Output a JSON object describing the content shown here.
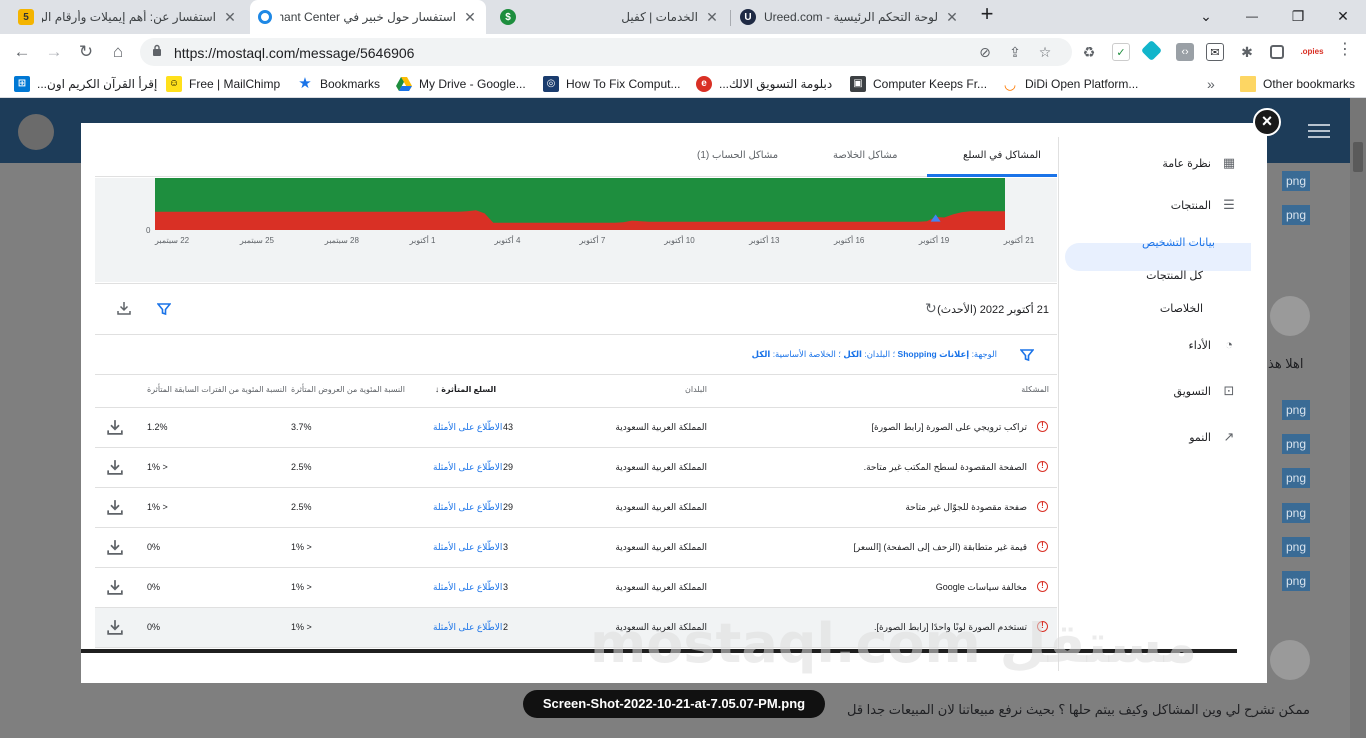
{
  "tabs": [
    {
      "label": "استفسار عن: أهم إيميلات وأرقام الن",
      "favicon": "5",
      "active": false
    },
    {
      "label": "استفسار حول خبير في hant Center",
      "favicon": "o",
      "active": true
    },
    {
      "label": "",
      "favicon": "$",
      "active": false
    },
    {
      "label": "الخدمات | كفيل",
      "favicon": "",
      "active": false
    },
    {
      "label": "لوحة التحكم الرئيسية - Ureed.com",
      "favicon": "U",
      "active": false
    }
  ],
  "new_tab_label": "+",
  "window_controls": {
    "chevron": "⌄",
    "minimize": "—",
    "restore": "❐",
    "close": "✕"
  },
  "address_bar": {
    "url": "https://mostaql.com/message/5646906"
  },
  "bookmarks": [
    {
      "label": "إقرأ القرآن الكريم اون...",
      "icon": "windows-icon"
    },
    {
      "label": "Free | MailChimp",
      "icon": "mailchimp-icon"
    },
    {
      "label": "Bookmarks",
      "icon": "star-icon"
    },
    {
      "label": "My Drive - Google...",
      "icon": "drive-icon"
    },
    {
      "label": "How To Fix Comput...",
      "icon": "globe-icon"
    },
    {
      "label": "دبلومة التسويق الالك...",
      "icon": "red-logo-icon"
    },
    {
      "label": "Computer Keeps Fr...",
      "icon": "square-icon"
    },
    {
      "label": "DiDi Open Platform...",
      "icon": "didi-icon"
    }
  ],
  "more_bookmarks": "»",
  "other_bookmarks": "Other bookmarks",
  "page_behind": {
    "png_label": "png",
    "comment_text": "اهلا هذ",
    "bottom_text": "ممكن تشرح لي وين المشاكل وكيف بيتم حلها ؟ بحيث نرفع مبيعاتنا لان المبيعات جدا قل"
  },
  "modal": {
    "close_label": "×",
    "caption": "Screen-Shot-2022-10-21-at-7.05.07-PM.png",
    "watermark": "مستقل mostaql.com"
  },
  "merchant_center": {
    "sidenav": [
      {
        "label": "نظرة عامة",
        "icon": "overview-icon"
      },
      {
        "label": "المنتجات",
        "icon": "products-icon"
      },
      {
        "label": "بيانات التشخيص",
        "sub": true,
        "active": true
      },
      {
        "label": "كل المنتجات",
        "sub": true
      },
      {
        "label": "الخلاصات",
        "sub": true
      },
      {
        "label": "الأداء",
        "icon": "performance-icon"
      },
      {
        "label": "التسويق",
        "icon": "marketing-icon"
      },
      {
        "label": "النمو",
        "icon": "growth-icon"
      }
    ],
    "tabs": [
      {
        "label": "المشاكل في السلع",
        "active": true
      },
      {
        "label": "مشاكل الخلاصة",
        "active": false
      },
      {
        "label": "مشاكل الحساب (1)",
        "active": false
      }
    ],
    "date_label": "21 أكتوبر 2022 (الأحدث)",
    "filter_text": {
      "prefix": "الوجهة:",
      "destination": "إعلانات Shopping",
      "middle": "؛ البلدان:",
      "country": "الكل",
      "suffix": "؛ الخلاصة الأساسية:",
      "feed": "الكل"
    },
    "columns": {
      "issue": "المشكلة",
      "country": "البلدان",
      "affected": "السلع المتأثرة",
      "pct_offers": "النسبة المئوية من العروض المتأثرة",
      "pct_prev": "النسبة المئوية من الفترات السابقة المتأثرة"
    },
    "view_examples": "الاطّلاع على الأمثلة",
    "rows": [
      {
        "issue": "تراكب ترويجي على الصورة [رابط الصورة]",
        "country": "المملكة العربية السعودية",
        "count": "43",
        "pct_offers": "3.7%",
        "pct_prev": "1.2%",
        "highlight": false
      },
      {
        "issue": "الصفحة المقصودة لسطح المكتب غير متاحة.",
        "country": "المملكة العربية السعودية",
        "count": "29",
        "pct_offers": "2.5%",
        "pct_prev": "< 1%",
        "highlight": false
      },
      {
        "issue": "صفحة مقصودة للجوّال غير متاحة",
        "country": "المملكة العربية السعودية",
        "count": "29",
        "pct_offers": "2.5%",
        "pct_prev": "< 1%",
        "highlight": false
      },
      {
        "issue": "قيمة غير متطابقة (الزحف إلى الصفحة) [السعر]",
        "country": "المملكة العربية السعودية",
        "count": "3",
        "pct_offers": "< 1%",
        "pct_prev": "0%",
        "highlight": false
      },
      {
        "issue": "مخالفة سياسات Google",
        "country": "المملكة العربية السعودية",
        "count": "3",
        "pct_offers": "< 1%",
        "pct_prev": "0%",
        "highlight": false
      },
      {
        "issue": "تستخدم الصورة لونًا واحدًا [رابط الصورة].",
        "country": "المملكة العربية السعودية",
        "count": "2",
        "pct_offers": "< 1%",
        "pct_prev": "0%",
        "highlight": true
      }
    ]
  },
  "chart_data": {
    "type": "area",
    "title": "",
    "xlabel": "",
    "ylabel": "",
    "x_ticks": [
      "22 سبتمبر",
      "25 سبتمبر",
      "28 سبتمبر",
      "1 أكتوبر",
      "4 أكتوبر",
      "7 أكتوبر",
      "10 أكتوبر",
      "13 أكتوبر",
      "16 أكتوبر",
      "19 أكتوبر",
      "21 أكتوبر"
    ],
    "y_tick_bottom": "0",
    "series": [
      {
        "color": "#d93025",
        "values": [
          0.35,
          0.35,
          0.35,
          0.35,
          0.35,
          0.35,
          0.35,
          0.35,
          0.35,
          0.35,
          0.35,
          0.35,
          0.35,
          0.35,
          0.35,
          0.35,
          0.35,
          0.35,
          0.35,
          0.35,
          0.35,
          0.35,
          0.35,
          0.35,
          0.35,
          0.35,
          0.35,
          0.35,
          0.35,
          0.35,
          0.35,
          0.35,
          0.35,
          0.35,
          0.35,
          0.35,
          0.36,
          0.38,
          0.32,
          0.14,
          0.14,
          0.14,
          0.14,
          0.14,
          0.14,
          0.14,
          0.14,
          0.14,
          0.14,
          0.14,
          0.14,
          0.14,
          0.14,
          0.14,
          0.15,
          0.18,
          0.17,
          0.16,
          0.16,
          0.16,
          0.16,
          0.16,
          0.16,
          0.16,
          0.16,
          0.16,
          0.16,
          0.16,
          0.16,
          0.16,
          0.16,
          0.16,
          0.16,
          0.16,
          0.16,
          0.16,
          0.16,
          0.16,
          0.16,
          0.16,
          0.16,
          0.16,
          0.16,
          0.16,
          0.16,
          0.16,
          0.16,
          0.16,
          0.16,
          0.17,
          0.25,
          0.24,
          0.3,
          0.34,
          0.36,
          0.36,
          0.36,
          0.36,
          0.36
        ]
      },
      {
        "color": "#1e8e3e",
        "values": [
          1,
          1,
          1,
          1,
          1,
          1,
          1,
          1,
          1,
          1,
          1,
          1,
          1,
          1,
          1,
          1,
          1,
          1,
          1,
          1,
          1,
          1,
          1,
          1,
          1,
          1,
          1,
          1,
          1,
          1,
          1,
          1,
          1,
          1,
          1,
          1,
          1,
          1,
          1,
          1,
          1,
          1,
          1,
          1,
          1,
          1,
          1,
          1,
          1,
          1,
          1,
          1,
          1,
          1,
          1,
          1,
          1,
          1,
          1,
          1,
          1,
          1,
          1,
          1,
          1,
          1,
          1,
          1,
          1,
          1,
          1,
          1,
          1,
          1,
          1,
          1,
          1,
          1,
          1,
          1,
          1,
          1,
          1,
          1,
          1,
          1,
          1,
          1,
          1,
          1,
          1,
          1,
          1,
          1,
          1,
          1,
          1,
          1,
          1
        ]
      }
    ],
    "ylim": [
      0,
      1
    ],
    "grid": false,
    "legend": "none"
  }
}
